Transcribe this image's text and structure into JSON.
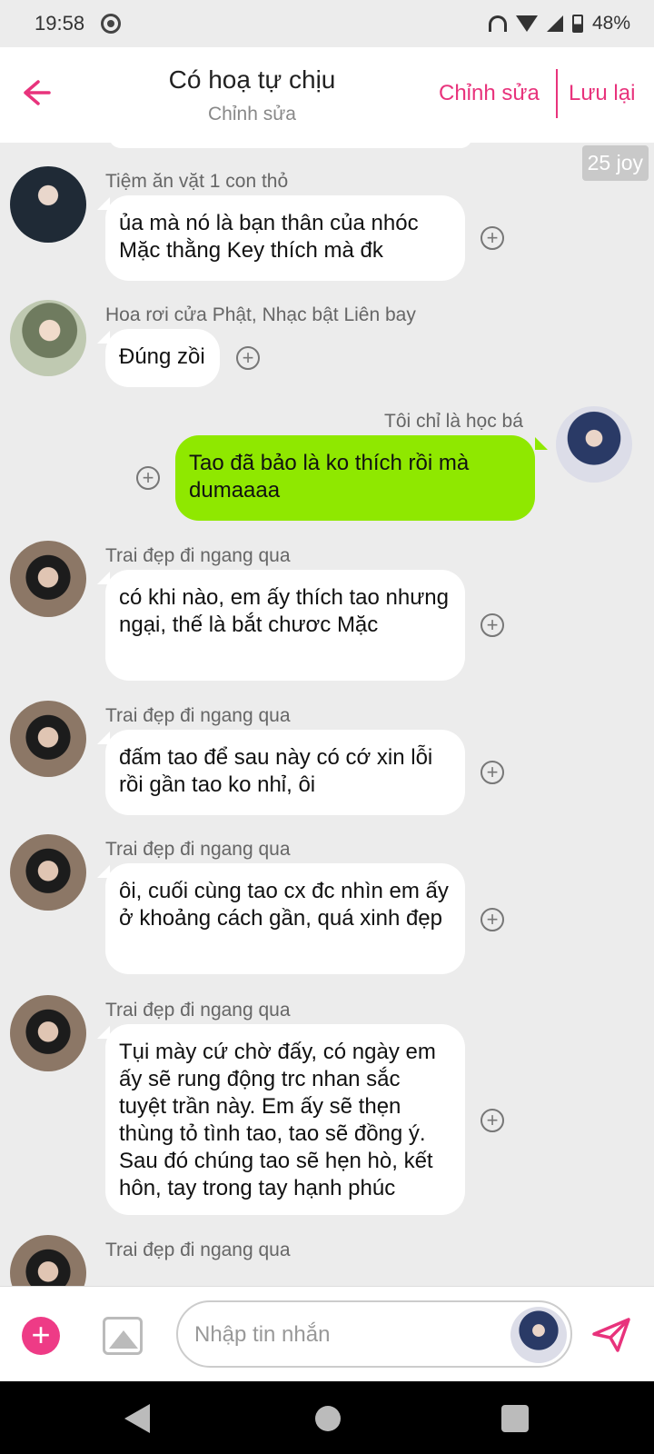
{
  "status_bar": {
    "time": "19:58",
    "battery": "48%"
  },
  "header": {
    "title": "Có hoạ tự chịu",
    "subtitle": "Chỉnh sửa",
    "edit_label": "Chỉnh sửa",
    "save_label": "Lưu lại"
  },
  "badge": "25 joy",
  "messages": [
    {
      "sender": "Tiệm ăn vặt 1 con thỏ",
      "text": "ủa mà nó là bạn thân của nhóc Mặc thằng Key thích mà đk",
      "mine": false
    },
    {
      "sender": "Hoa rơi cửa Phật, Nhạc bật Liên bay",
      "text": "Đúng zồi",
      "mine": false
    },
    {
      "sender": "Tôi chỉ là học bá",
      "text": "Tao đã bảo là ko thích rồi mà dumaaaa",
      "mine": true
    },
    {
      "sender": "Trai đẹp đi ngang qua",
      "text": "có khi nào, em ấy thích tao nhưng ngại, thế là bắt chươc Mặc",
      "mine": false
    },
    {
      "sender": "Trai đẹp đi ngang qua",
      "text": "đấm tao để sau này có cớ xin lỗi rồi gần tao ko nhỉ, ôi",
      "mine": false
    },
    {
      "sender": "Trai đẹp đi ngang qua",
      "text": "ôi, cuối cùng tao cx đc nhìn em ấy ở khoảng cách gần, quá xinh đẹp",
      "mine": false
    },
    {
      "sender": "Trai đẹp đi ngang qua",
      "text": "Tụi mày cứ chờ đấy, có ngày em ấy sẽ rung động trc nhan sắc tuyệt trần này. Em ấy sẽ thẹn thùng tỏ tình tao, tao sẽ đồng ý. Sau đó chúng tao sẽ hẹn hò, kết hôn, tay trong tay hạnh phúc",
      "mine": false
    },
    {
      "sender": "Trai đẹp đi ngang qua",
      "text": "",
      "mine": false
    }
  ],
  "composer": {
    "placeholder": "Nhập tin nhắn"
  },
  "colors": {
    "accent": "#e8337c",
    "my_bubble": "#8fe800",
    "background": "#ececec"
  }
}
